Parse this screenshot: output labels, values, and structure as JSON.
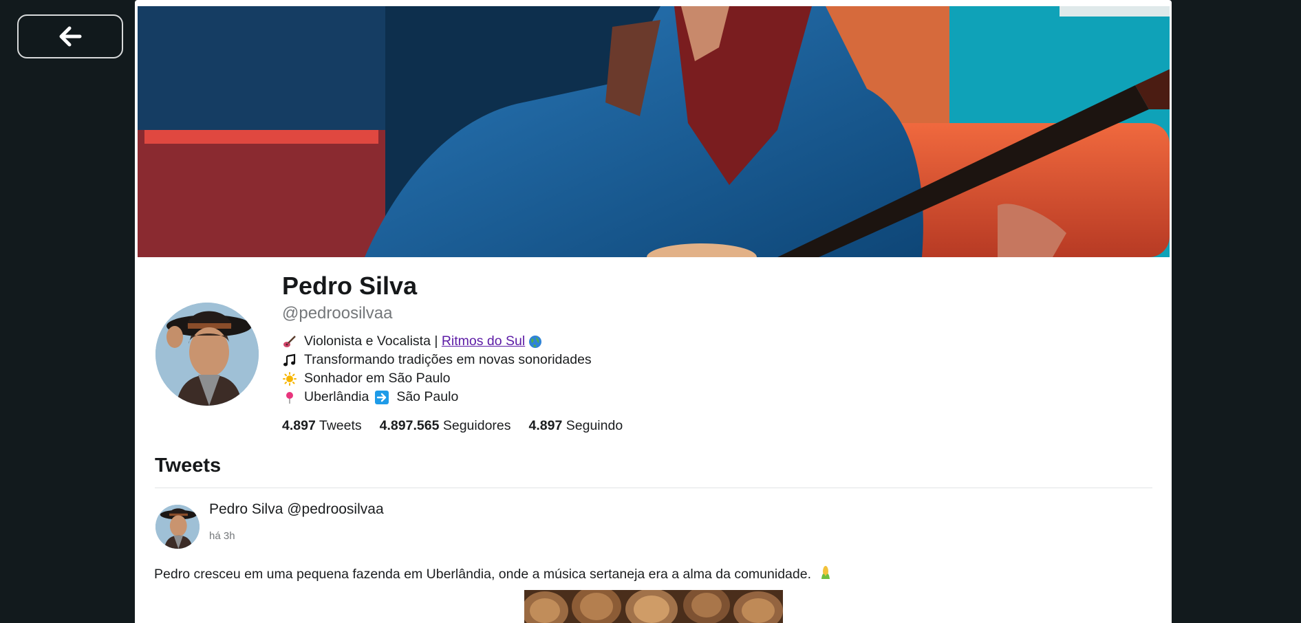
{
  "nav": {
    "back_icon": "arrow-left-icon"
  },
  "profile": {
    "name": "Pedro Silva",
    "handle": "@pedroosilvaa",
    "banner_description": "banner",
    "bio": [
      {
        "icon": "guitar-emoji-icon",
        "text": "Violonista e Vocalista | ",
        "link": "Ritmos do Sul",
        "suffix_icon": "globe-emoji-icon"
      },
      {
        "icon": "music-note-emoji-icon",
        "text": "Transformando tradições em novas sonoridades"
      },
      {
        "icon": "sun-emoji-icon",
        "text": "Sonhador em São Paulo"
      },
      {
        "icon": "pin-emoji-icon",
        "text": "Uberlândia",
        "arrow_icon": "right-arrow-emoji-icon",
        "text2": "São Paulo"
      }
    ],
    "stats": [
      {
        "value": "4.897",
        "label": "Tweets"
      },
      {
        "value": "4.897.565",
        "label": "Seguidores"
      },
      {
        "value": "4.897",
        "label": "Seguindo"
      }
    ]
  },
  "tweets_section": {
    "title": "Tweets",
    "items": [
      {
        "author": "Pedro Silva @pedroosilvaa",
        "time": "há 3h",
        "text": "Pedro cresceu em uma pequena fazenda em Uberlândia, onde a música sertaneja era a alma da comunidade.",
        "emoji_icon": "corn-emoji-icon"
      }
    ]
  },
  "colors": {
    "background": "#121a1d",
    "card": "#ffffff",
    "link": "#5b1aa5",
    "muted": "#74777a"
  }
}
